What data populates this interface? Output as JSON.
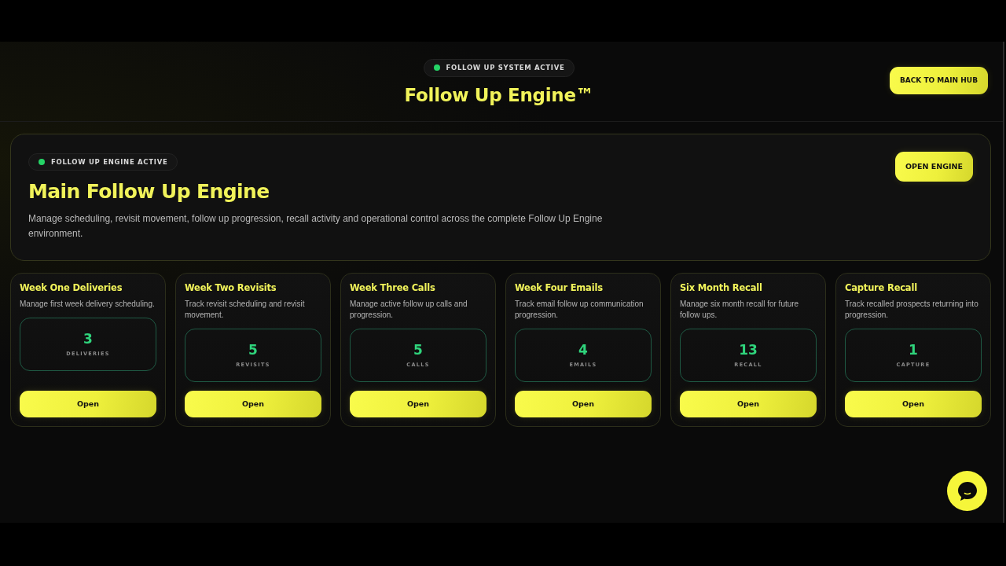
{
  "header": {
    "status_badge": "FOLLOW UP SYSTEM ACTIVE",
    "title": "Follow Up Engine™",
    "back_button": "BACK TO MAIN HUB"
  },
  "hero": {
    "status_badge": "FOLLOW UP ENGINE ACTIVE",
    "title": "Main Follow Up Engine",
    "description": "Manage scheduling, revisit movement, follow up progression, recall activity and operational control across the complete Follow Up Engine environment.",
    "button": "OPEN ENGINE"
  },
  "modules": [
    {
      "title": "Week One Deliveries",
      "description": "Manage first week delivery scheduling.",
      "count": "3",
      "unit": "DELIVERIES",
      "button": "Open"
    },
    {
      "title": "Week Two Revisits",
      "description": "Track revisit scheduling and revisit movement.",
      "count": "5",
      "unit": "REVISITS",
      "button": "Open"
    },
    {
      "title": "Week Three Calls",
      "description": "Manage active follow up calls and progression.",
      "count": "5",
      "unit": "CALLS",
      "button": "Open"
    },
    {
      "title": "Week Four Emails",
      "description": "Track email follow up communication progression.",
      "count": "4",
      "unit": "EMAILS",
      "button": "Open"
    },
    {
      "title": "Six Month Recall",
      "description": "Manage six month recall for future follow ups.",
      "count": "13",
      "unit": "RECALL",
      "button": "Open"
    },
    {
      "title": "Capture Recall",
      "description": "Track recalled prospects returning into progression.",
      "count": "1",
      "unit": "CAPTURE",
      "button": "Open"
    }
  ]
}
